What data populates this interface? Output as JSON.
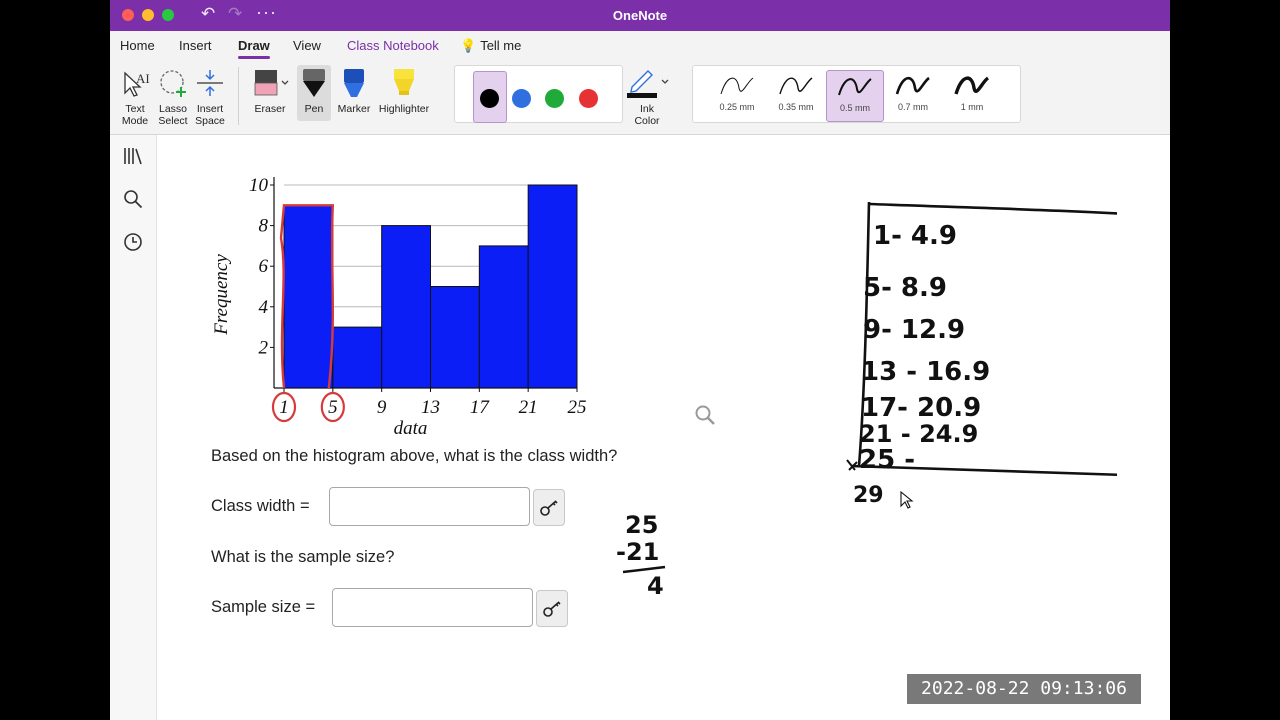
{
  "window": {
    "title": "OneNote"
  },
  "ribbon": {
    "tabs": [
      {
        "label": "Home"
      },
      {
        "label": "Insert"
      },
      {
        "label": "Draw"
      },
      {
        "label": "View"
      },
      {
        "label": "Class Notebook"
      },
      {
        "label": "Tell me"
      }
    ],
    "active_tab": "Draw",
    "tools": {
      "text_mode": [
        "Text",
        "Mode"
      ],
      "lasso_select": [
        "Lasso",
        "Select"
      ],
      "insert_space": [
        "Insert",
        "Space"
      ],
      "eraser": "Eraser",
      "pen": "Pen",
      "marker": "Marker",
      "highlighter": "Highlighter",
      "ink_color": [
        "Ink",
        "Color"
      ]
    },
    "pen_colors": [
      "#000000",
      "#2f6fe0",
      "#1faa3a",
      "#e63232"
    ],
    "selected_pen_color": "#000000",
    "thickness": [
      {
        "label": "0.25 mm"
      },
      {
        "label": "0.35 mm"
      },
      {
        "label": "0.5 mm"
      },
      {
        "label": "0.7 mm"
      },
      {
        "label": "1 mm"
      }
    ],
    "selected_thickness": "0.5 mm"
  },
  "sidebar": {
    "icons": [
      "notebooks-icon",
      "search-icon",
      "recent-icon"
    ]
  },
  "chart_data": {
    "type": "bar",
    "categories": [
      "1",
      "5",
      "9",
      "13",
      "17",
      "21",
      "25"
    ],
    "bins": [
      [
        1,
        5
      ],
      [
        5,
        9
      ],
      [
        9,
        13
      ],
      [
        13,
        17
      ],
      [
        17,
        21
      ],
      [
        21,
        25
      ]
    ],
    "values": [
      9,
      3,
      8,
      5,
      7,
      10
    ],
    "xlabel": "data",
    "ylabel": "Frequency",
    "ylim": [
      0,
      10
    ],
    "yticks": [
      "2",
      "4",
      "6",
      "8",
      "10"
    ],
    "grid": true,
    "bar_color": "#0a1ef5"
  },
  "questions": [
    {
      "prompt": "Based on the histogram above, what is the class width?"
    },
    {
      "field_label": "Class width =",
      "value": ""
    },
    {
      "prompt": "What is the sample size?"
    },
    {
      "field_label": "Sample size =",
      "value": ""
    }
  ],
  "ink": {
    "subtraction": [
      "25",
      "-21",
      "4"
    ],
    "class_table": [
      "1- 4.9",
      "5- 8.9",
      "9- 12.9",
      "13 - 16.9",
      "17- 20.9",
      "21 - 24.9",
      "25 -",
      "29"
    ]
  },
  "timestamp": "2022-08-22 09:13:06",
  "colors": {
    "title_bar": "#7b2fa8",
    "annotation_red": "#d63b3b"
  }
}
